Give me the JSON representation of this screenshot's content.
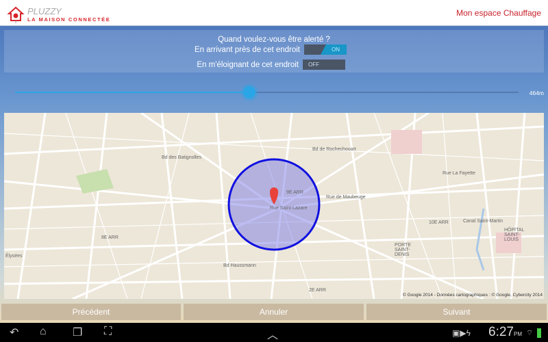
{
  "header": {
    "brand": "PLUZZY",
    "tagline": "LA MAISON CONNECTÉE",
    "link": "Mon espace Chauffage"
  },
  "alerts": {
    "question": "Quand voulez-vous être alerté ?",
    "arriving_label": "En arrivant près de cet endroit",
    "arriving_state": "ON",
    "leaving_label": "En m'éloignant de cet endroit",
    "leaving_state": "OFF"
  },
  "radius": {
    "value_label": "464m",
    "fraction": 0.46
  },
  "map": {
    "labels": [
      "9E ARR",
      "Rue Saint-Lazare",
      "10E ARR",
      "8E ARR",
      "Canal Saint-Martin",
      "PORTE SAINT-DENIS",
      "HÔPITAL SAINT-LOUIS",
      "2E ARR",
      "Élysées",
      "Bd Haussmann",
      "Rue de Maubeuge",
      "Rue La Fayette",
      "Bd de Rochechouart",
      "Bd des Batignolles"
    ],
    "attribution": "© Google 2014 - Données cartographiques : © Google, Cybercity 2014",
    "circle_color": "#1010e0"
  },
  "buttons": {
    "previous": "Précédent",
    "cancel": "Annuler",
    "next": "Suivant"
  },
  "status": {
    "time": "6:27",
    "ampm": "PM"
  },
  "colors": {
    "accent": "#2aa6e6",
    "brand": "#d8242c"
  }
}
